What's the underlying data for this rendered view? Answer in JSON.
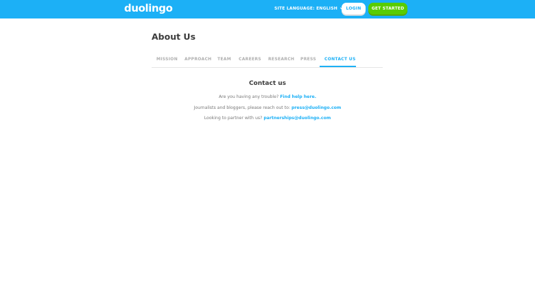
{
  "header": {
    "logo_text": "duolingo",
    "site_language_label": "SITE LANGUAGE: ENGLISH",
    "login_label": "LOGIN",
    "get_started_label": "GET STARTED"
  },
  "page": {
    "title": "About Us"
  },
  "tabs": [
    {
      "label": "MISSION"
    },
    {
      "label": "APPROACH"
    },
    {
      "label": "TEAM"
    },
    {
      "label": "CAREERS"
    },
    {
      "label": "RESEARCH"
    },
    {
      "label": "PRESS"
    },
    {
      "label": "CONTACT US",
      "active": true
    }
  ],
  "contact": {
    "title": "Contact us",
    "trouble_text": "Are you having any trouble?",
    "trouble_link": "Find help here.",
    "press_text": "Journalists and bloggers, please reach out to:",
    "press_link": "press@duolingo.com",
    "partner_text": "Looking to partner with us?",
    "partner_link": "partnerships@duolingo.com"
  },
  "colors": {
    "brand_blue": "#1cb0f6",
    "brand_green": "#58cc02",
    "text_dark": "#3c3c3c",
    "text_muted": "#777777",
    "tab_inactive": "#afafaf"
  },
  "icons": {
    "language_chevron": "chevron-down-icon"
  }
}
